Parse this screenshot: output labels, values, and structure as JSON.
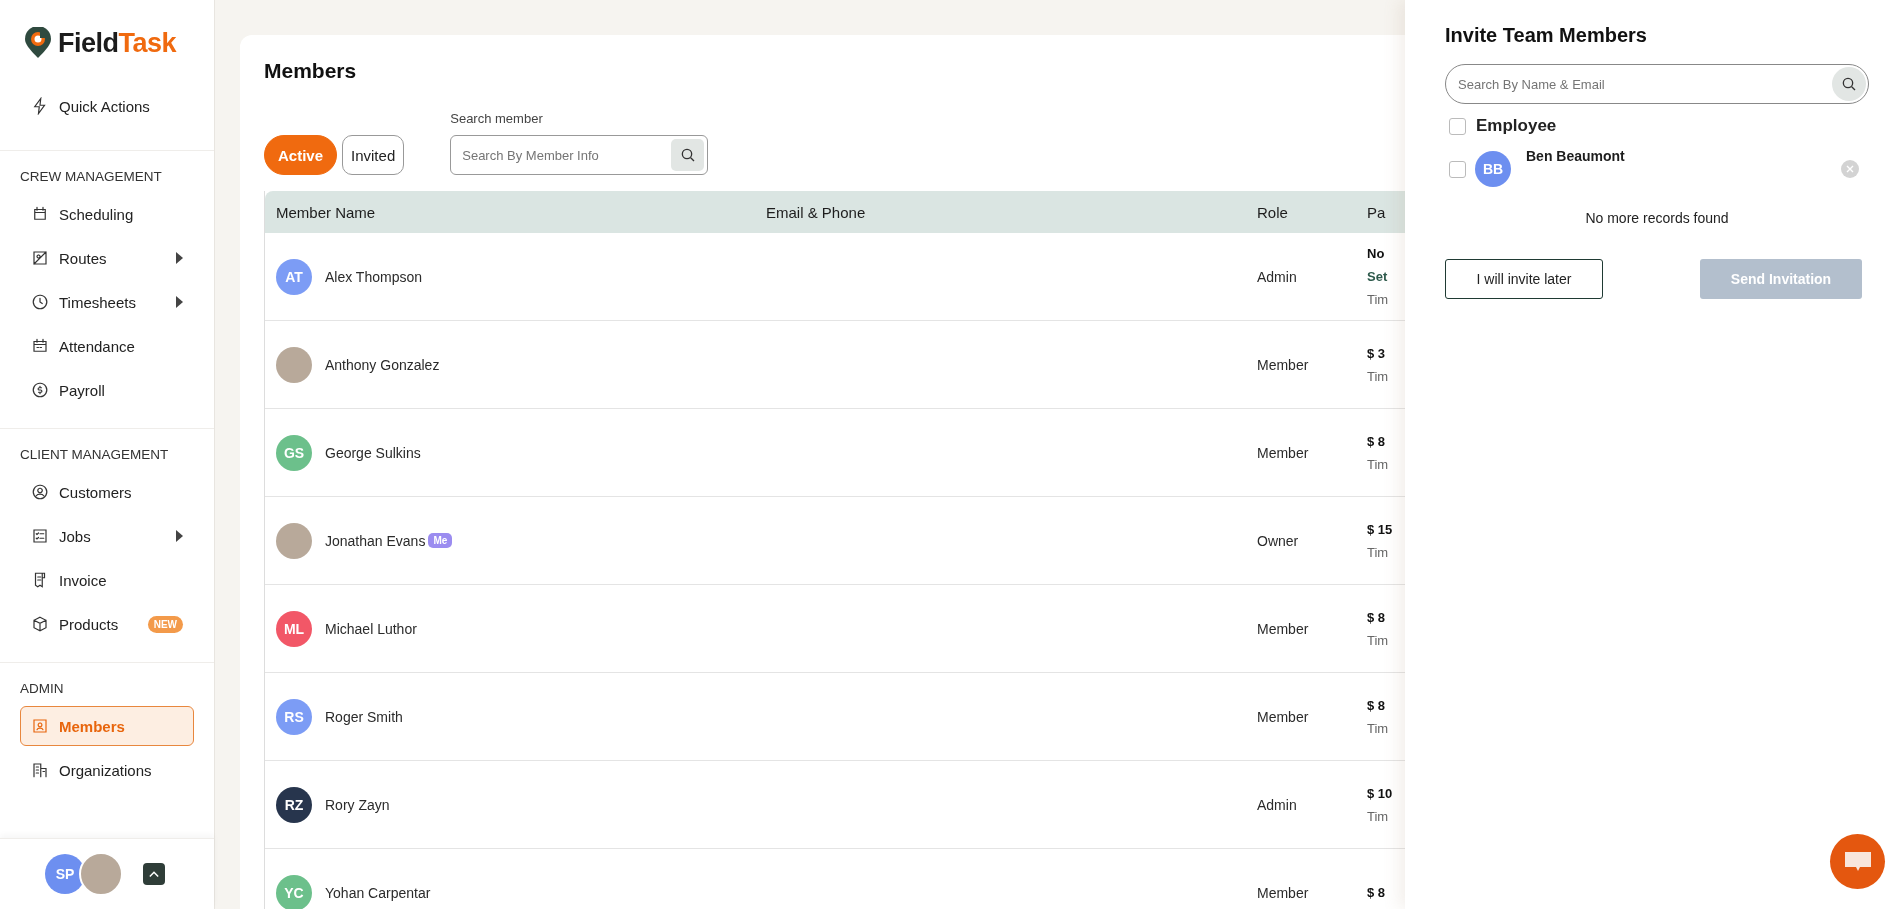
{
  "brand": {
    "name_first": "Field",
    "name_second": "Task"
  },
  "sidebar": {
    "quick_action": {
      "label": "Quick Actions"
    },
    "sections": [
      {
        "heading": "CREW MANAGEMENT",
        "items": [
          {
            "label": "Scheduling",
            "expandable": false,
            "selected": false
          },
          {
            "label": "Routes",
            "expandable": true,
            "selected": false
          },
          {
            "label": "Timesheets",
            "expandable": true,
            "selected": false
          },
          {
            "label": "Attendance",
            "expandable": false,
            "selected": false
          },
          {
            "label": "Payroll",
            "expandable": false,
            "selected": false
          }
        ]
      },
      {
        "heading": "CLIENT MANAGEMENT",
        "items": [
          {
            "label": "Customers",
            "expandable": false,
            "selected": false
          },
          {
            "label": "Jobs",
            "expandable": true,
            "selected": false
          },
          {
            "label": "Invoice",
            "expandable": false,
            "selected": false
          },
          {
            "label": "Products",
            "expandable": false,
            "badge": "NEW",
            "selected": false
          }
        ]
      },
      {
        "heading": "ADMIN",
        "items": [
          {
            "label": "Members",
            "expandable": false,
            "selected": true
          },
          {
            "label": "Organizations",
            "expandable": false,
            "selected": false
          }
        ]
      }
    ],
    "user": {
      "initials": "SP"
    }
  },
  "page": {
    "title": "Members",
    "tabs": [
      {
        "label": "Active",
        "selected": true
      },
      {
        "label": "Invited",
        "selected": false
      }
    ],
    "search": {
      "label": "Search member",
      "placeholder": "Search By Member Info"
    }
  },
  "table": {
    "columns": [
      "Member Name",
      "Email & Phone",
      "Role",
      "Pa"
    ],
    "rows": [
      {
        "kind": "initials",
        "initials": "AT",
        "color": "#7c9cf5",
        "name": "Alex Thompson",
        "role": "Admin",
        "pay": [
          "No",
          "Set",
          "Tim"
        ]
      },
      {
        "kind": "photo",
        "name": "Anthony Gonzalez",
        "role": "Member",
        "pay": [
          "$ 3",
          "Tim"
        ]
      },
      {
        "kind": "initials",
        "initials": "GS",
        "color": "#6cc08b",
        "name": "George Sulkins",
        "role": "Member",
        "pay": [
          "$ 8",
          "Tim"
        ]
      },
      {
        "kind": "photo",
        "name": "Jonathan Evans",
        "badge": "Me",
        "role": "Owner",
        "pay": [
          "$ 15",
          "Tim"
        ]
      },
      {
        "kind": "initials",
        "initials": "ML",
        "color": "#f25767",
        "name": "Michael Luthor",
        "role": "Member",
        "pay": [
          "$ 8",
          "Tim"
        ]
      },
      {
        "kind": "initials",
        "initials": "RS",
        "color": "#7c9cf5",
        "name": "Roger Smith",
        "role": "Member",
        "pay": [
          "$ 8",
          "Tim"
        ]
      },
      {
        "kind": "initials",
        "initials": "RZ",
        "color": "#27354d",
        "name": "Rory Zayn",
        "role": "Admin",
        "pay": [
          "$ 10",
          "Tim"
        ]
      },
      {
        "kind": "initials",
        "initials": "YC",
        "color": "#6cc08b",
        "name": "Yohan Carpentar",
        "role": "Member",
        "pay": [
          "$ 8"
        ]
      }
    ]
  },
  "drawer": {
    "title": "Invite Team Members",
    "search": {
      "placeholder": "Search By Name & Email"
    },
    "group": {
      "label": "Employee",
      "checked": false
    },
    "people": [
      {
        "initials": "BB",
        "name": "Ben Beaumont",
        "checked": false
      }
    ],
    "empty_note": "No more records found",
    "buttons": [
      {
        "label": "I will invite later",
        "kind": "secondary",
        "disabled": false
      },
      {
        "label": "Send Invitation",
        "kind": "primary",
        "disabled": true
      }
    ]
  }
}
